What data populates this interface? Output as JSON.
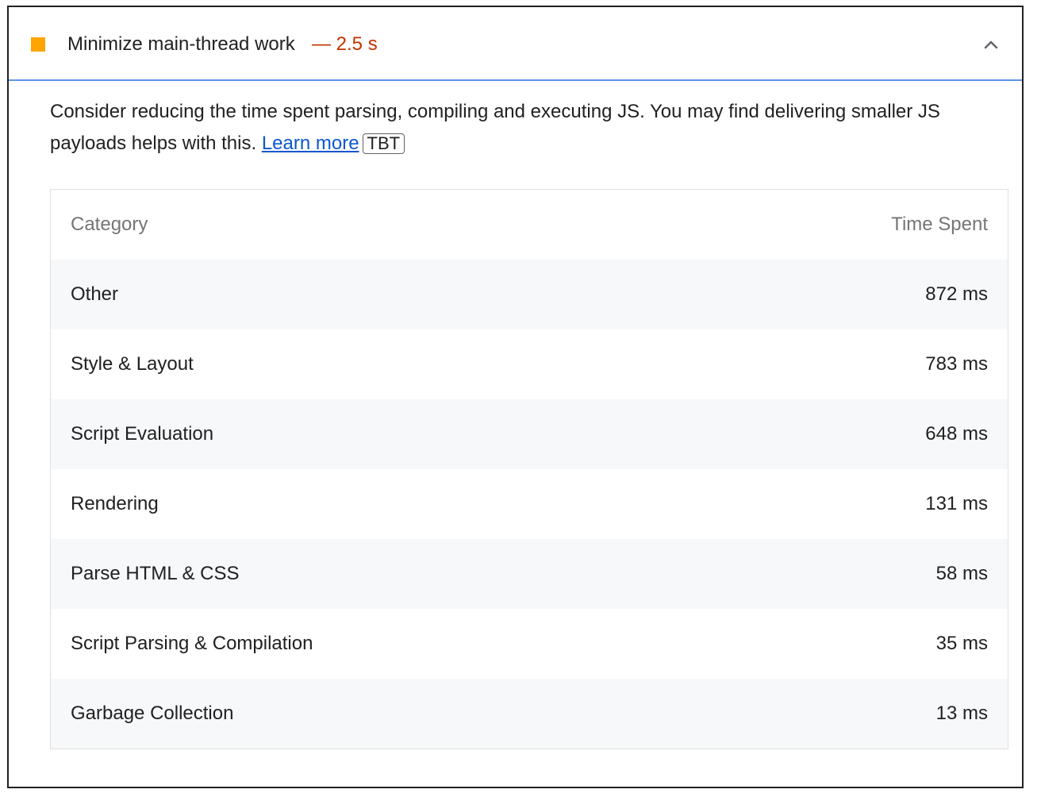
{
  "audit": {
    "title": "Minimize main-thread work",
    "value": "— 2.5 s",
    "colors": {
      "score": "#ffa400",
      "value": "#c33300",
      "link": "#0b57d0"
    }
  },
  "description": {
    "text": "Consider reducing the time spent parsing, compiling and executing JS. You may find delivering smaller JS payloads helps with this. ",
    "link_label": "Learn more",
    "badge": "TBT"
  },
  "table": {
    "headers": {
      "category": "Category",
      "time": "Time Spent"
    },
    "rows": [
      {
        "category": "Other",
        "time": "872 ms"
      },
      {
        "category": "Style & Layout",
        "time": "783 ms"
      },
      {
        "category": "Script Evaluation",
        "time": "648 ms"
      },
      {
        "category": "Rendering",
        "time": "131 ms"
      },
      {
        "category": "Parse HTML & CSS",
        "time": "58 ms"
      },
      {
        "category": "Script Parsing & Compilation",
        "time": "35 ms"
      },
      {
        "category": "Garbage Collection",
        "time": "13 ms"
      }
    ]
  }
}
